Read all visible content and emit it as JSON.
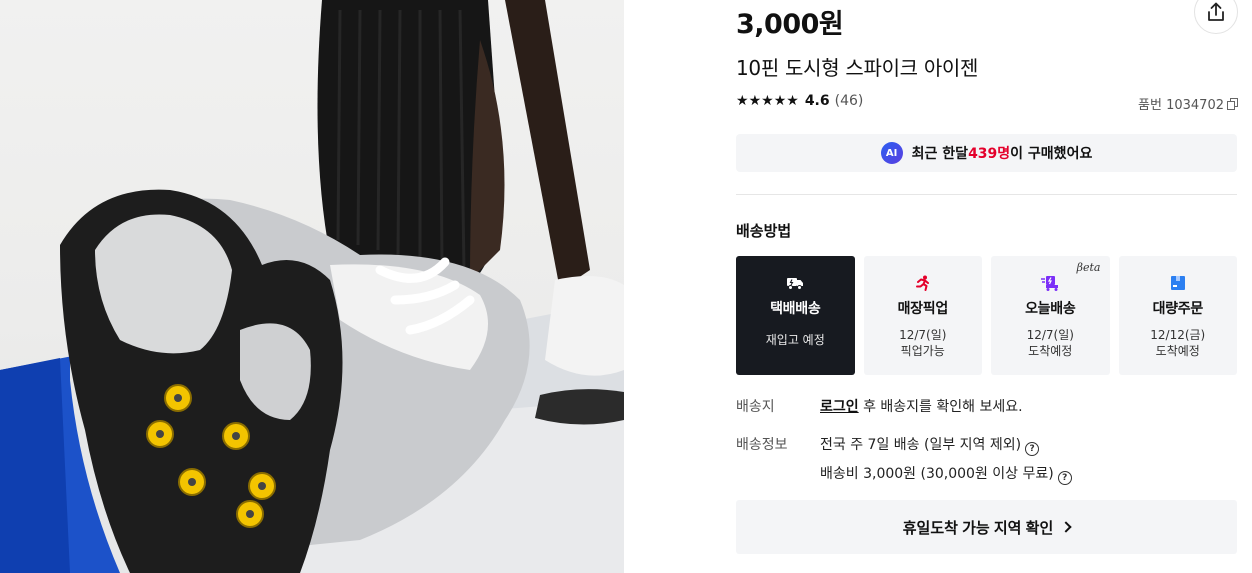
{
  "product": {
    "image_alt": "",
    "price": "3,000원",
    "title": "10핀 도시형 스파이크 아이젠",
    "rating": {
      "stars": [
        "★",
        "★",
        "★",
        "★",
        "★"
      ],
      "score": "4.6",
      "review_count": "(46)"
    },
    "sku_label": "품번 1034702"
  },
  "share": {
    "icon": "share-upload-icon"
  },
  "ai_banner": {
    "badge": "AI",
    "prefix": "최근 한달 ",
    "count": "439명",
    "suffix": "이 구매했어요",
    "highlight_color": "#e4002b"
  },
  "delivery": {
    "section_title": "배송방법",
    "methods": [
      {
        "label": "택배배송",
        "sub1": "재입고 예정",
        "sub2": "",
        "icon": "truck-icon",
        "icon_color": "#ffffff",
        "selected": true
      },
      {
        "label": "매장픽업",
        "sub1": "12/7(일)",
        "sub2": "픽업가능",
        "icon": "running-person-icon",
        "icon_color": "#e4002b",
        "selected": false
      },
      {
        "label": "오늘배송",
        "sub1": "12/7(일)",
        "sub2": "도착예정",
        "icon": "fast-delivery-icon",
        "icon_color": "#7b2ff7",
        "selected": false,
        "badge": "βeta"
      },
      {
        "label": "대량주문",
        "sub1": "12/12(금)",
        "sub2": "도착예정",
        "icon": "bulk-box-icon",
        "icon_color": "#2b7ff1",
        "selected": false
      }
    ],
    "address": {
      "label": "배송지",
      "login_link": "로그인",
      "text": " 후 배송지를 확인해 보세요."
    },
    "info": {
      "label": "배송정보",
      "line1": "전국 주 7일 배송 (일부 지역 제외)",
      "line2": "배송비 3,000원 (30,000원 이상 무료)"
    },
    "holiday_button": "휴일도착 가능 지역 확인"
  },
  "colors": {
    "accent_red": "#e4002b",
    "selected_bg": "#171a20",
    "card_bg": "#f4f5f7"
  }
}
